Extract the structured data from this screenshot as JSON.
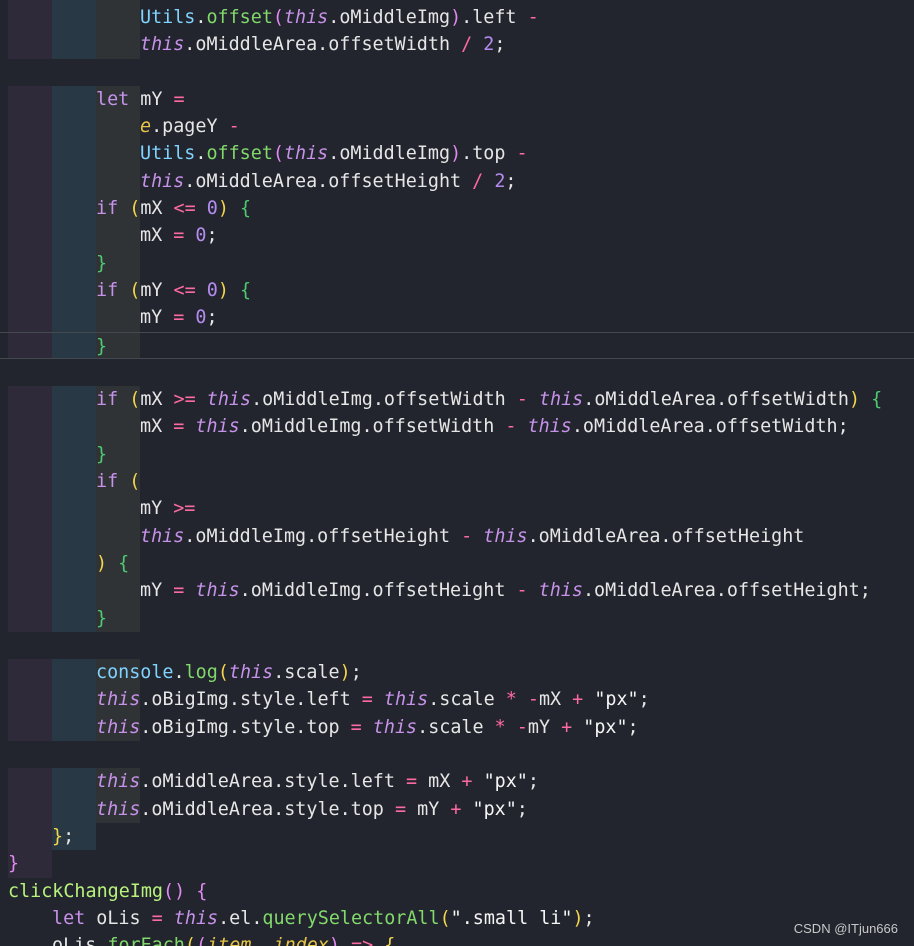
{
  "watermark": "CSDN @ITjun666",
  "lines": [
    {
      "indent": 3,
      "band": true,
      "tokens": [
        [
          "ctor",
          "Utils"
        ],
        [
          "punc",
          "."
        ],
        [
          "fn",
          "offset"
        ],
        [
          "brace-p",
          "("
        ],
        [
          "this",
          "this"
        ],
        [
          "punc",
          ".oMiddleImg"
        ],
        [
          "brace-p",
          ")"
        ],
        [
          "punc",
          ".left "
        ],
        [
          "op",
          "-"
        ]
      ]
    },
    {
      "indent": 3,
      "band": true,
      "tokens": [
        [
          "this",
          "this"
        ],
        [
          "punc",
          ".oMiddleArea.offsetWidth "
        ],
        [
          "op",
          "/"
        ],
        [
          "punc",
          " "
        ],
        [
          "num",
          "2"
        ],
        [
          "punc",
          ";"
        ]
      ]
    },
    {
      "indent": 0,
      "band": false,
      "blank": true,
      "tokens": []
    },
    {
      "indent": 2,
      "band": true,
      "tokens": [
        [
          "kw",
          "let"
        ],
        [
          "punc",
          " mY "
        ],
        [
          "op",
          "="
        ]
      ]
    },
    {
      "indent": 3,
      "band": true,
      "tokens": [
        [
          "param",
          "e"
        ],
        [
          "punc",
          ".pageY "
        ],
        [
          "op",
          "-"
        ]
      ]
    },
    {
      "indent": 3,
      "band": true,
      "tokens": [
        [
          "ctor",
          "Utils"
        ],
        [
          "punc",
          "."
        ],
        [
          "fn",
          "offset"
        ],
        [
          "brace-p",
          "("
        ],
        [
          "this",
          "this"
        ],
        [
          "punc",
          ".oMiddleImg"
        ],
        [
          "brace-p",
          ")"
        ],
        [
          "punc",
          ".top "
        ],
        [
          "op",
          "-"
        ]
      ]
    },
    {
      "indent": 3,
      "band": true,
      "tokens": [
        [
          "this",
          "this"
        ],
        [
          "punc",
          ".oMiddleArea.offsetHeight "
        ],
        [
          "op",
          "/"
        ],
        [
          "punc",
          " "
        ],
        [
          "num",
          "2"
        ],
        [
          "punc",
          ";"
        ]
      ]
    },
    {
      "indent": 2,
      "band": true,
      "tokens": [
        [
          "kw",
          "if"
        ],
        [
          "punc",
          " "
        ],
        [
          "brace-y",
          "("
        ],
        [
          "punc",
          "mX "
        ],
        [
          "op",
          "<="
        ],
        [
          "punc",
          " "
        ],
        [
          "num",
          "0"
        ],
        [
          "brace-y",
          ")"
        ],
        [
          "punc",
          " "
        ],
        [
          "brace-g",
          "{"
        ]
      ]
    },
    {
      "indent": 3,
      "band": true,
      "tokens": [
        [
          "punc",
          "mX "
        ],
        [
          "op",
          "="
        ],
        [
          "punc",
          " "
        ],
        [
          "num",
          "0"
        ],
        [
          "punc",
          ";"
        ]
      ]
    },
    {
      "indent": 2,
      "band": true,
      "tokens": [
        [
          "brace-g",
          "}"
        ]
      ]
    },
    {
      "indent": 2,
      "band": true,
      "tokens": [
        [
          "kw",
          "if"
        ],
        [
          "punc",
          " "
        ],
        [
          "brace-y",
          "("
        ],
        [
          "punc",
          "mY "
        ],
        [
          "op",
          "<="
        ],
        [
          "punc",
          " "
        ],
        [
          "num",
          "0"
        ],
        [
          "brace-y",
          ")"
        ],
        [
          "punc",
          " "
        ],
        [
          "brace-g",
          "{"
        ]
      ]
    },
    {
      "indent": 3,
      "band": true,
      "tokens": [
        [
          "punc",
          "mY "
        ],
        [
          "op",
          "="
        ],
        [
          "punc",
          " "
        ],
        [
          "num",
          "0"
        ],
        [
          "punc",
          ";"
        ]
      ]
    },
    {
      "indent": 2,
      "band": true,
      "cursor": true,
      "tokens": [
        [
          "brace-g",
          "}"
        ]
      ]
    },
    {
      "indent": 0,
      "band": false,
      "blank": true,
      "tokens": []
    },
    {
      "indent": 2,
      "band": true,
      "tokens": [
        [
          "kw",
          "if"
        ],
        [
          "punc",
          " "
        ],
        [
          "brace-y",
          "("
        ],
        [
          "punc",
          "mX "
        ],
        [
          "op",
          ">="
        ],
        [
          "punc",
          " "
        ],
        [
          "this",
          "this"
        ],
        [
          "punc",
          ".oMiddleImg.offsetWidth "
        ],
        [
          "op",
          "-"
        ],
        [
          "punc",
          " "
        ],
        [
          "this",
          "this"
        ],
        [
          "punc",
          ".oMiddleArea.offsetWidth"
        ],
        [
          "brace-y",
          ")"
        ],
        [
          "punc",
          " "
        ],
        [
          "brace-g",
          "{"
        ]
      ]
    },
    {
      "indent": 3,
      "band": true,
      "tokens": [
        [
          "punc",
          "mX "
        ],
        [
          "op",
          "="
        ],
        [
          "punc",
          " "
        ],
        [
          "this",
          "this"
        ],
        [
          "punc",
          ".oMiddleImg.offsetWidth "
        ],
        [
          "op",
          "-"
        ],
        [
          "punc",
          " "
        ],
        [
          "this",
          "this"
        ],
        [
          "punc",
          ".oMiddleArea.offsetWidth;"
        ]
      ]
    },
    {
      "indent": 2,
      "band": true,
      "tokens": [
        [
          "brace-g",
          "}"
        ]
      ]
    },
    {
      "indent": 2,
      "band": true,
      "tokens": [
        [
          "kw",
          "if"
        ],
        [
          "punc",
          " "
        ],
        [
          "brace-y",
          "("
        ]
      ]
    },
    {
      "indent": 3,
      "band": true,
      "tokens": [
        [
          "punc",
          "mY "
        ],
        [
          "op",
          ">="
        ]
      ]
    },
    {
      "indent": 3,
      "band": true,
      "tokens": [
        [
          "this",
          "this"
        ],
        [
          "punc",
          ".oMiddleImg.offsetHeight "
        ],
        [
          "op",
          "-"
        ],
        [
          "punc",
          " "
        ],
        [
          "this",
          "this"
        ],
        [
          "punc",
          ".oMiddleArea.offsetHeight"
        ]
      ]
    },
    {
      "indent": 2,
      "band": true,
      "tokens": [
        [
          "brace-y",
          ")"
        ],
        [
          "punc",
          " "
        ],
        [
          "brace-g",
          "{"
        ]
      ]
    },
    {
      "indent": 3,
      "band": true,
      "tokens": [
        [
          "punc",
          "mY "
        ],
        [
          "op",
          "="
        ],
        [
          "punc",
          " "
        ],
        [
          "this",
          "this"
        ],
        [
          "punc",
          ".oMiddleImg.offsetHeight "
        ],
        [
          "op",
          "-"
        ],
        [
          "punc",
          " "
        ],
        [
          "this",
          "this"
        ],
        [
          "punc",
          ".oMiddleArea.offsetHeight;"
        ]
      ]
    },
    {
      "indent": 2,
      "band": true,
      "tokens": [
        [
          "brace-g",
          "}"
        ]
      ]
    },
    {
      "indent": 0,
      "band": false,
      "blank": true,
      "tokens": []
    },
    {
      "indent": 2,
      "band": true,
      "tokens": [
        [
          "ctor",
          "console"
        ],
        [
          "punc",
          "."
        ],
        [
          "fn",
          "log"
        ],
        [
          "brace-y",
          "("
        ],
        [
          "this",
          "this"
        ],
        [
          "punc",
          ".scale"
        ],
        [
          "brace-y",
          ")"
        ],
        [
          "punc",
          ";"
        ]
      ]
    },
    {
      "indent": 2,
      "band": true,
      "tokens": [
        [
          "this",
          "this"
        ],
        [
          "punc",
          ".oBigImg.style.left "
        ],
        [
          "op",
          "="
        ],
        [
          "punc",
          " "
        ],
        [
          "this",
          "this"
        ],
        [
          "punc",
          ".scale "
        ],
        [
          "op",
          "*"
        ],
        [
          "punc",
          " "
        ],
        [
          "op",
          "-"
        ],
        [
          "punc",
          "mX "
        ],
        [
          "op",
          "+"
        ],
        [
          "punc",
          " "
        ],
        [
          "str",
          "\"px\""
        ],
        [
          "punc",
          ";"
        ]
      ]
    },
    {
      "indent": 2,
      "band": true,
      "tokens": [
        [
          "this",
          "this"
        ],
        [
          "punc",
          ".oBigImg.style.top "
        ],
        [
          "op",
          "="
        ],
        [
          "punc",
          " "
        ],
        [
          "this",
          "this"
        ],
        [
          "punc",
          ".scale "
        ],
        [
          "op",
          "*"
        ],
        [
          "punc",
          " "
        ],
        [
          "op",
          "-"
        ],
        [
          "punc",
          "mY "
        ],
        [
          "op",
          "+"
        ],
        [
          "punc",
          " "
        ],
        [
          "str",
          "\"px\""
        ],
        [
          "punc",
          ";"
        ]
      ]
    },
    {
      "indent": 0,
      "band": false,
      "blank": true,
      "tokens": []
    },
    {
      "indent": 2,
      "band": true,
      "tokens": [
        [
          "this",
          "this"
        ],
        [
          "punc",
          ".oMiddleArea.style.left "
        ],
        [
          "op",
          "="
        ],
        [
          "punc",
          " mX "
        ],
        [
          "op",
          "+"
        ],
        [
          "punc",
          " "
        ],
        [
          "str",
          "\"px\""
        ],
        [
          "punc",
          ";"
        ]
      ]
    },
    {
      "indent": 2,
      "band": true,
      "tokens": [
        [
          "this",
          "this"
        ],
        [
          "punc",
          ".oMiddleArea.style.top "
        ],
        [
          "op",
          "="
        ],
        [
          "punc",
          " mY "
        ],
        [
          "op",
          "+"
        ],
        [
          "punc",
          " "
        ],
        [
          "str",
          "\"px\""
        ],
        [
          "punc",
          ";"
        ]
      ]
    },
    {
      "indent": 1,
      "band": true,
      "tokens": [
        [
          "brace-y",
          "}"
        ],
        [
          "punc",
          ";"
        ]
      ]
    },
    {
      "indent": 0,
      "band": true,
      "tokens": [
        [
          "brace-p",
          "}"
        ]
      ]
    },
    {
      "indent": 0,
      "band": false,
      "tokens": [
        [
          "method-def",
          "clickChangeImg"
        ],
        [
          "brace-p",
          "("
        ],
        [
          "brace-p",
          ")"
        ],
        [
          "punc",
          " "
        ],
        [
          "brace-p",
          "{"
        ]
      ]
    },
    {
      "indent": 1,
      "band": false,
      "tokens": [
        [
          "kw",
          "let"
        ],
        [
          "punc",
          " oLis "
        ],
        [
          "op",
          "="
        ],
        [
          "punc",
          " "
        ],
        [
          "this",
          "this"
        ],
        [
          "punc",
          ".el."
        ],
        [
          "fn",
          "querySelectorAll"
        ],
        [
          "brace-y",
          "("
        ],
        [
          "str",
          "\".small li\""
        ],
        [
          "brace-y",
          ")"
        ],
        [
          "punc",
          ";"
        ]
      ]
    },
    {
      "indent": 1,
      "band": false,
      "tokens": [
        [
          "punc",
          "oLis."
        ],
        [
          "fn",
          "forEach"
        ],
        [
          "brace-y",
          "("
        ],
        [
          "brace-p",
          "("
        ],
        [
          "param",
          "item"
        ],
        [
          "punc",
          ", "
        ],
        [
          "param",
          "index"
        ],
        [
          "brace-p",
          ")"
        ],
        [
          "punc",
          " "
        ],
        [
          "op",
          "=>"
        ],
        [
          "punc",
          " "
        ],
        [
          "brace-y",
          "{"
        ]
      ]
    }
  ]
}
